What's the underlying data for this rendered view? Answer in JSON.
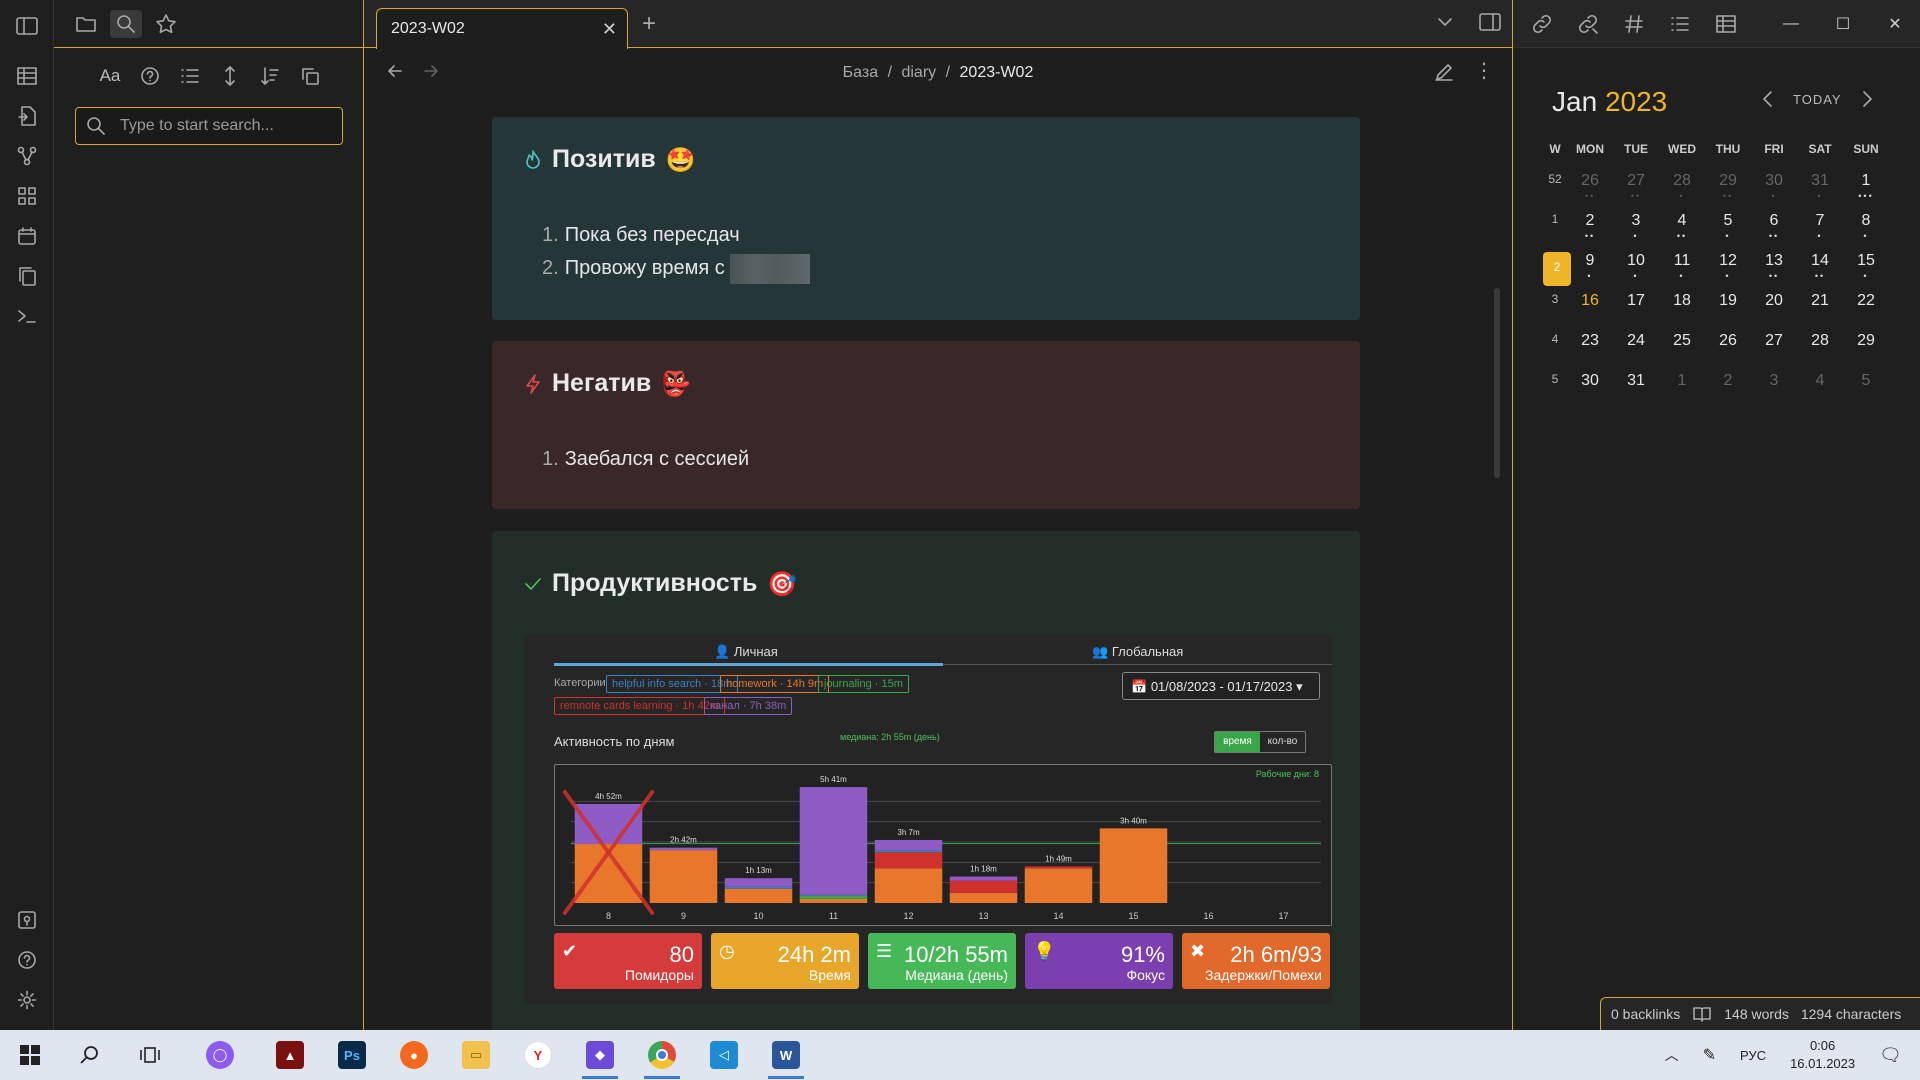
{
  "tabs": {
    "active_title": "2023-W02"
  },
  "breadcrumb": {
    "part1": "База",
    "sep1": "/",
    "part2": "diary",
    "sep2": "/",
    "current": "2023-W02"
  },
  "search": {
    "placeholder": "Type to start search..."
  },
  "search_tools": {
    "match_case": "Aa"
  },
  "positive": {
    "title": "Позитив",
    "emoji": "🤩",
    "items": [
      {
        "num": "1.",
        "text": "Пока без пересдач"
      },
      {
        "num": "2.",
        "text": "Провожу время с"
      }
    ]
  },
  "negative": {
    "title": "Негатив",
    "emoji": "👺",
    "items": [
      {
        "num": "1.",
        "text": "Заебался с сессией"
      }
    ]
  },
  "productivity": {
    "title": "Продуктивность",
    "emoji": "🎯",
    "tab_personal": "Личная",
    "tab_global": "Глобальная",
    "categories_label": "Категории",
    "chips": [
      {
        "text": "helpful info search · 18m",
        "color": "#3f7fbf"
      },
      {
        "text": "homework · 14h 9m",
        "color": "#e8762b"
      },
      {
        "text": "journaling · 15m",
        "color": "#3aa64a"
      },
      {
        "text": "remnote cards learning · 1h 42m",
        "color": "#d0312d"
      },
      {
        "text": "канал · 7h 38m",
        "color": "#8e5cc4"
      }
    ],
    "date_range": "01/08/2023 - 01/17/2023",
    "activity_title": "Активность по дням",
    "median_note": "медиана: 2h 55m (день)",
    "toggle_on": "время",
    "toggle_off": "кол-во",
    "workdays": "Рабочие дни: 8",
    "stats": [
      {
        "value": "80",
        "label": "Помидоры",
        "color": "#d63b3b",
        "icon": "✔"
      },
      {
        "value": "24h 2m",
        "label": "Время",
        "color": "#e8a72b",
        "icon": "◷"
      },
      {
        "value": "10/2h 55m",
        "label": "Медиана (день)",
        "color": "#46b857",
        "icon": "☰"
      },
      {
        "value": "91%",
        "label": "Фокус",
        "color": "#7c3fb0",
        "icon": "💡"
      },
      {
        "value": "2h 6m/93",
        "label": "Задержки/Помехи",
        "color": "#e0692b",
        "icon": "✖"
      }
    ]
  },
  "chart_data": {
    "type": "bar",
    "stacked": true,
    "categories": [
      "8",
      "9",
      "10",
      "11",
      "12",
      "13",
      "14",
      "15",
      "16",
      "17"
    ],
    "total_labels": [
      "4h 52m",
      "2h 42m",
      "1h 13m",
      "5h 41m",
      "3h 7m",
      "1h 18m",
      "1h 49m",
      "3h 40m",
      "",
      ""
    ],
    "ylim": [
      0,
      6
    ],
    "series": [
      {
        "color": "#e8762b",
        "values": [
          2.9,
          2.6,
          0.7,
          0.2,
          1.7,
          0.5,
          1.7,
          3.67,
          0,
          0
        ]
      },
      {
        "color": "#3aa64a",
        "values": [
          0,
          0,
          0,
          0.15,
          0,
          0,
          0,
          0,
          0,
          0
        ]
      },
      {
        "color": "#d0312d",
        "values": [
          0,
          0,
          0,
          0,
          0.8,
          0.6,
          0.1,
          0,
          0,
          0
        ]
      },
      {
        "color": "#3f7fbf",
        "values": [
          0,
          0,
          0.1,
          0.05,
          0.1,
          0,
          0,
          0,
          0,
          0
        ]
      },
      {
        "color": "#8e5cc4",
        "values": [
          1.97,
          0.12,
          0.42,
          5.3,
          0.5,
          0.2,
          0,
          0,
          0,
          0
        ]
      }
    ],
    "crossed_out_category": "8",
    "median_hours": 2.92
  },
  "calendar": {
    "month": "Jan",
    "year": "2023",
    "today_label": "TODAY",
    "headers": [
      "W",
      "MON",
      "TUE",
      "WED",
      "THU",
      "FRI",
      "SAT",
      "SUN"
    ],
    "weeks": [
      {
        "wk": "52",
        "days": [
          {
            "d": "26",
            "dim": true,
            "dots": "••"
          },
          {
            "d": "27",
            "dim": true,
            "dots": "••"
          },
          {
            "d": "28",
            "dim": true,
            "dots": "•"
          },
          {
            "d": "29",
            "dim": true,
            "dots": "••"
          },
          {
            "d": "30",
            "dim": true,
            "dots": "•"
          },
          {
            "d": "31",
            "dim": true,
            "dots": "•"
          },
          {
            "d": "1",
            "dots": "•••"
          }
        ]
      },
      {
        "wk": "1",
        "days": [
          {
            "d": "2",
            "dots": "••"
          },
          {
            "d": "3",
            "dots": "•"
          },
          {
            "d": "4",
            "dots": "••"
          },
          {
            "d": "5",
            "dots": "•"
          },
          {
            "d": "6",
            "dots": "••"
          },
          {
            "d": "7",
            "dots": "•"
          },
          {
            "d": "8",
            "dots": "•"
          }
        ]
      },
      {
        "wk": "2",
        "active": true,
        "days": [
          {
            "d": "9",
            "dots": "•"
          },
          {
            "d": "10",
            "dots": "•"
          },
          {
            "d": "11",
            "dots": "•"
          },
          {
            "d": "12",
            "dots": "•"
          },
          {
            "d": "13",
            "dots": "••"
          },
          {
            "d": "14",
            "dots": "••"
          },
          {
            "d": "15",
            "dots": "•"
          }
        ]
      },
      {
        "wk": "3",
        "days": [
          {
            "d": "16",
            "today": true,
            "dots": ""
          },
          {
            "d": "17",
            "dots": ""
          },
          {
            "d": "18",
            "dots": ""
          },
          {
            "d": "19",
            "dots": ""
          },
          {
            "d": "20",
            "dots": ""
          },
          {
            "d": "21",
            "dots": ""
          },
          {
            "d": "22",
            "dots": ""
          }
        ]
      },
      {
        "wk": "4",
        "days": [
          {
            "d": "23",
            "dots": ""
          },
          {
            "d": "24",
            "dots": ""
          },
          {
            "d": "25",
            "dots": ""
          },
          {
            "d": "26",
            "dots": ""
          },
          {
            "d": "27",
            "dots": ""
          },
          {
            "d": "28",
            "dots": ""
          },
          {
            "d": "29",
            "dots": ""
          }
        ]
      },
      {
        "wk": "5",
        "days": [
          {
            "d": "30",
            "dots": ""
          },
          {
            "d": "31",
            "dots": ""
          },
          {
            "d": "1",
            "dim": true,
            "dots": ""
          },
          {
            "d": "2",
            "dim": true,
            "dots": ""
          },
          {
            "d": "3",
            "dim": true,
            "dots": ""
          },
          {
            "d": "4",
            "dim": true,
            "dots": ""
          },
          {
            "d": "5",
            "dim": true,
            "dots": ""
          }
        ]
      }
    ]
  },
  "status": {
    "backlinks": "0 backlinks",
    "words": "148 words",
    "characters": "1294 characters"
  },
  "taskbar": {
    "lang": "РУС",
    "time": "0:06",
    "date": "16.01.2023"
  },
  "colors": {
    "accent": "#d6a72a",
    "calendar_accent": "#f0b429",
    "positive_bg": "#243638",
    "negative_bg": "#3a2828",
    "productivity_bg": "#232e28"
  }
}
